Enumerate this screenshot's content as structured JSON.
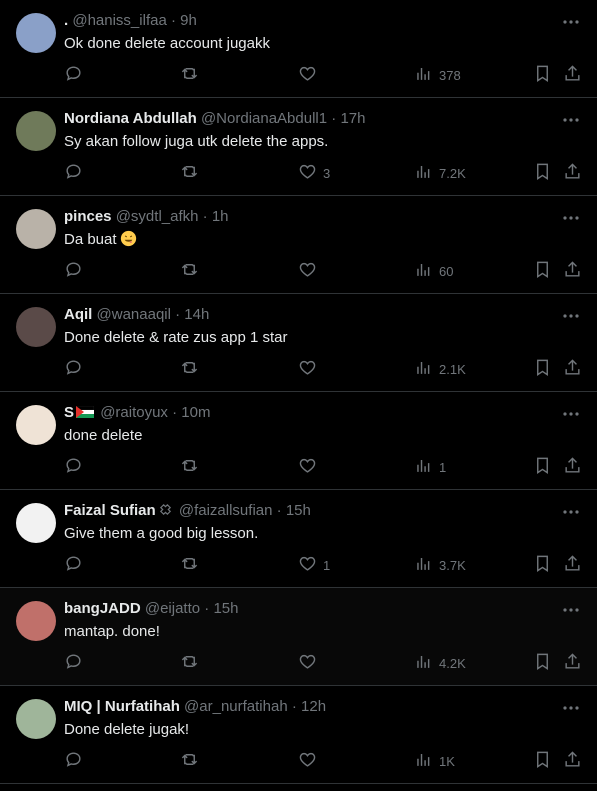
{
  "tweets": [
    {
      "display_name": ".",
      "handle": "@haniss_ilfaa",
      "time": "9h",
      "text": "Ok done delete account jugakk",
      "likes": "",
      "views": "378",
      "avatar_color": "#8aa0c8",
      "highlight": false
    },
    {
      "display_name": "Nordiana Abdullah",
      "handle": "@NordianaAbdull1",
      "time": "17h",
      "text": "Sy akan follow juga utk delete the apps.",
      "likes": "3",
      "views": "7.2K",
      "avatar_color": "#6f7a5a",
      "highlight": false
    },
    {
      "display_name": "pinces",
      "handle": "@sydtl_afkh",
      "time": "1h",
      "text": "Da buat",
      "emoji": "face-savoring-food-emoji",
      "likes": "",
      "views": "60",
      "avatar_color": "#b9b2a8",
      "highlight": false
    },
    {
      "display_name": "Aqil",
      "handle": "@wanaaqil",
      "time": "14h",
      "text": "Done delete & rate zus app 1 star",
      "likes": "",
      "views": "2.1K",
      "avatar_color": "#5a4a48",
      "highlight": false
    },
    {
      "display_name": "S",
      "handle": "@raitoyux",
      "time": "10m",
      "text": "done delete",
      "flag": "palestine-flag",
      "likes": "",
      "views": "1",
      "avatar_color": "#efe3d6",
      "highlight": false
    },
    {
      "display_name": "Faizal Sufian",
      "handle": "@faizallsufian",
      "time": "15h",
      "text": "Give them a good big lesson.",
      "badge": "verified-icon",
      "likes": "1",
      "views": "3.7K",
      "avatar_color": "#f2f2f2",
      "highlight": false
    },
    {
      "display_name": "bangJADD",
      "handle": "@eijatto",
      "time": "15h",
      "text": "mantap. done!",
      "likes": "",
      "views": "4.2K",
      "avatar_color": "#c0706a",
      "highlight": true
    },
    {
      "display_name": "MIQ | Nurfatihah",
      "handle": "@ar_nurfatihah",
      "time": "12h",
      "text": "Done delete jugak!",
      "likes": "",
      "views": "1K",
      "avatar_color": "#9fb59a",
      "highlight": false
    }
  ],
  "separator": "·",
  "colors": {
    "background": "#000000",
    "text": "#e7e9ea",
    "muted": "#71767b",
    "border": "#2f3336"
  }
}
